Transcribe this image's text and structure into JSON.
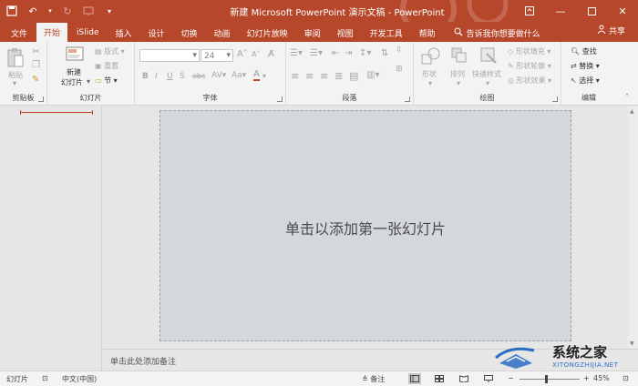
{
  "titlebar": {
    "title": "新建 Microsoft PowerPoint 演示文稿 - PowerPoint",
    "color": "#b7472a"
  },
  "tabs": [
    {
      "label": "文件"
    },
    {
      "label": "开始",
      "active": true
    },
    {
      "label": "iSlide"
    },
    {
      "label": "插入"
    },
    {
      "label": "设计"
    },
    {
      "label": "切换"
    },
    {
      "label": "动画"
    },
    {
      "label": "幻灯片放映"
    },
    {
      "label": "审阅"
    },
    {
      "label": "视图"
    },
    {
      "label": "开发工具"
    },
    {
      "label": "帮助"
    }
  ],
  "tell_me": "告诉我你想要做什么",
  "share": "共享",
  "ribbon": {
    "clipboard": {
      "paste": "粘贴",
      "label": "剪贴板"
    },
    "slides": {
      "new_slide_line1": "新建",
      "new_slide_line2": "幻灯片",
      "layout": "版式",
      "reset": "重置",
      "section": "节",
      "label": "幻灯片"
    },
    "font": {
      "font_name": "",
      "font_size": "24",
      "label": "字体"
    },
    "paragraph": {
      "label": "段落"
    },
    "drawing": {
      "shapes": "形状",
      "arrange": "排列",
      "quick_styles": "快速样式",
      "shape_fill": "形状填充",
      "shape_outline": "形状轮廓",
      "shape_effects": "形状效果",
      "label": "绘图"
    },
    "editing": {
      "find": "查找",
      "replace": "替换",
      "select": "选择",
      "label": "编辑"
    }
  },
  "slide": {
    "placeholder": "单击以添加第一张幻灯片"
  },
  "notes_placeholder": "单击此处添加备注",
  "status": {
    "slide": "幻灯片",
    "language": "中文(中国)",
    "notes": "备注",
    "zoom": "45%"
  },
  "watermark": {
    "brand": "系统之家",
    "url": "XITONGZHIJIA.NET"
  }
}
